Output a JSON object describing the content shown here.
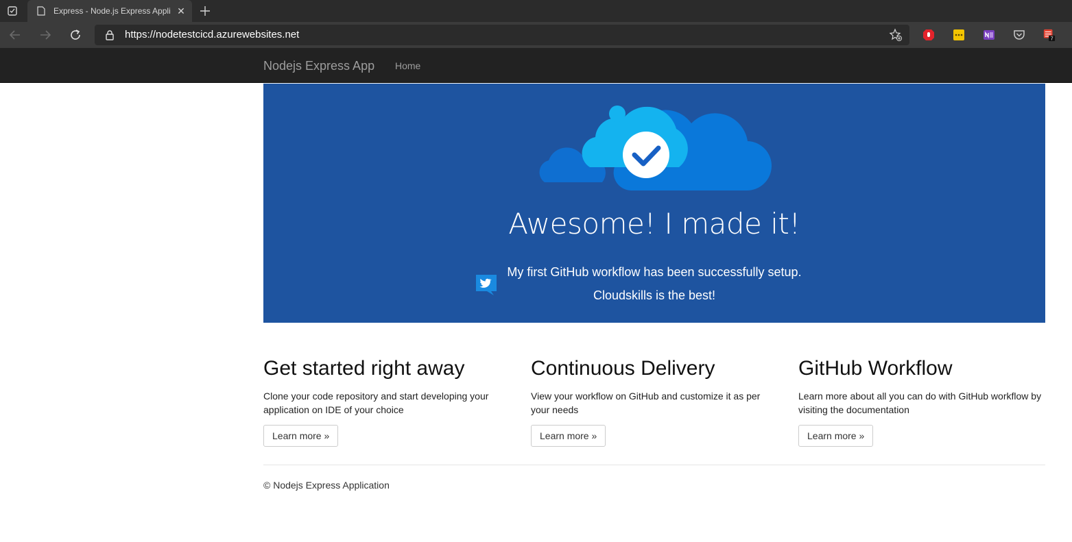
{
  "browser": {
    "tab_title": "Express - Node.js Express Applic",
    "url": "https://nodetestcicd.azurewebsites.net",
    "extensions": [
      {
        "name": "adblock-icon",
        "color": "#e3232b"
      },
      {
        "name": "notes-icon",
        "color": "#f3c400"
      },
      {
        "name": "onenote-icon",
        "color": "#7a3fbf"
      },
      {
        "name": "pocket-icon",
        "color": "#cccccc"
      },
      {
        "name": "todoist-icon",
        "color": "#e44332",
        "badge": "7"
      }
    ]
  },
  "navbar": {
    "brand": "Nodejs Express App",
    "links": [
      "Home"
    ]
  },
  "hero": {
    "heading": "Awesome! I made it!",
    "line1": "My first GitHub workflow has been successfully setup.",
    "line2": "Cloudskills is the best!",
    "background": "#1e54a0"
  },
  "columns": [
    {
      "heading": "Get started right away",
      "text": "Clone your code repository and start developing your application on IDE of your choice",
      "button": "Learn more »"
    },
    {
      "heading": "Continuous Delivery",
      "text": "View your workflow on GitHub and customize it as per your needs",
      "button": "Learn more »"
    },
    {
      "heading": "GitHub Workflow",
      "text": "Learn more about all you can do with GitHub workflow by visiting the documentation",
      "button": "Learn more »"
    }
  ],
  "footer": {
    "text": "© Nodejs Express Application"
  }
}
